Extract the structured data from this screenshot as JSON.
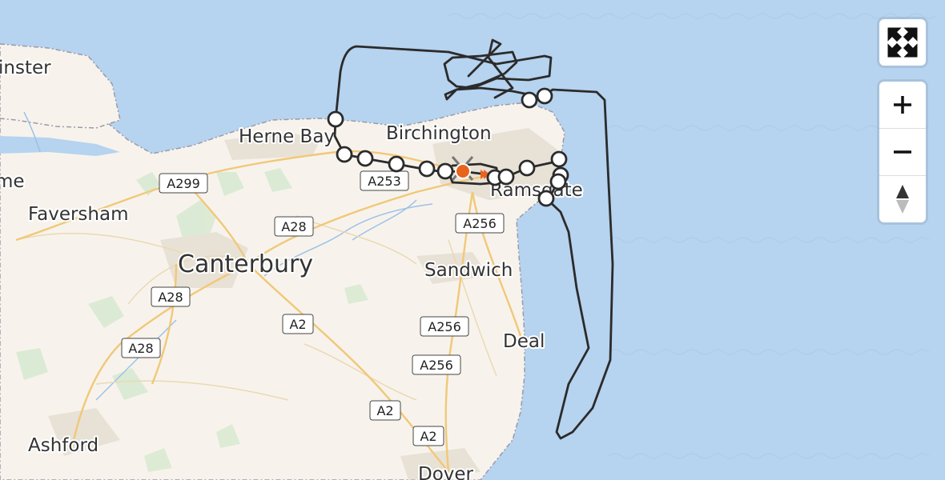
{
  "map": {
    "places": [
      {
        "name": "Herne Bay",
        "size": "medium"
      },
      {
        "name": "Birchington",
        "size": "medium"
      },
      {
        "name": "Ramsgate",
        "size": "medium"
      },
      {
        "name": "Faversham",
        "size": "medium"
      },
      {
        "name": "Canterbury",
        "size": "large"
      },
      {
        "name": "Sandwich",
        "size": "medium"
      },
      {
        "name": "Deal",
        "size": "medium"
      },
      {
        "name": "Ashford",
        "size": "medium"
      },
      {
        "name": "Dover",
        "size": "medium"
      },
      {
        "name": "inster",
        "size": "medium"
      },
      {
        "name": "me",
        "size": "medium"
      }
    ],
    "road_labels": [
      "A299",
      "A253",
      "A28",
      "A256",
      "A28",
      "A2",
      "A256",
      "A28",
      "A256",
      "A2",
      "A2"
    ],
    "colors": {
      "sea": "#b6d3ef",
      "land": "#f7f3ec",
      "route": "#2b2b2b",
      "waypoint_fill": "#ffffff",
      "marker": "#e8641e"
    }
  },
  "controls": {
    "fullscreen_icon": "fullscreen-icon",
    "zoom_in_icon": "plus-icon",
    "zoom_out_icon": "minus-icon",
    "compass_icon": "compass-icon"
  }
}
